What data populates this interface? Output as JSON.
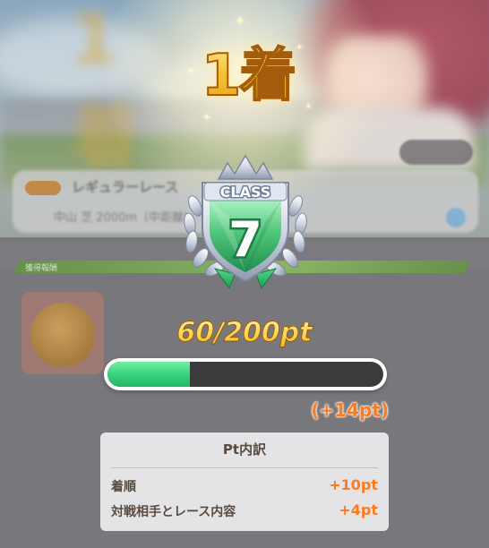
{
  "result": {
    "placement": "1着",
    "ghost_placement": "1着"
  },
  "race_info": {
    "name": "レギュラーレース",
    "detail": "中山 芝 2000m（中距離）"
  },
  "section_label": "獲得報酬",
  "class_badge": {
    "label": "CLASS",
    "number": "7"
  },
  "points": {
    "current_total": "60/200pt",
    "progress": 0.3,
    "gain": "(+14pt)"
  },
  "breakdown": {
    "title": "Pt内訳",
    "rows": [
      {
        "label": "着順",
        "value": "+10pt"
      },
      {
        "label": "対戦相手とレース内容",
        "value": "+4pt"
      }
    ]
  },
  "colors": {
    "accent_orange": "#ff7a1e",
    "bar_green": "#35d07a",
    "gold": "#f6c33a",
    "badge_green": "#4fc57a"
  }
}
